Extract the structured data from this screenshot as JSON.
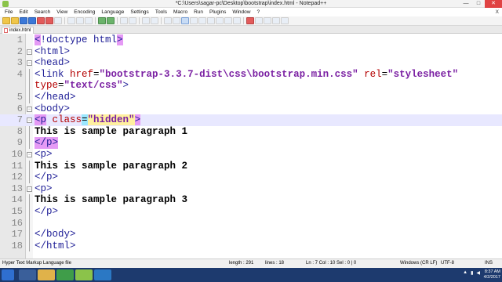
{
  "window": {
    "title": "*C:\\Users\\sagar-pc\\Desktop\\bootstrap\\index.html - Notepad++",
    "minimize": "—",
    "maximize": "□",
    "close": "✕"
  },
  "menu": {
    "items": [
      "File",
      "Edit",
      "Search",
      "View",
      "Encoding",
      "Language",
      "Settings",
      "Tools",
      "Macro",
      "Run",
      "Plugins",
      "Window",
      "?"
    ],
    "close_label": "X"
  },
  "tab": {
    "label": "index.html"
  },
  "editor": {
    "lines": [
      "1",
      "2",
      "3",
      "4",
      "",
      "5",
      "6",
      "7",
      "8",
      "9",
      "10",
      "11",
      "12",
      "13",
      "14",
      "15",
      "16",
      "17",
      "18"
    ],
    "code": {
      "l1_open": "<",
      "l1_rest": "!doctype html",
      "l1_close": ">",
      "l2": "<html>",
      "l3": "<head>",
      "l4_a": "<link ",
      "l4_attr1": "href",
      "l4_eq1": "=",
      "l4_val1": "\"bootstrap-3.3.7-dist\\css\\bootstrap.min.css\"",
      "l4_attr2": " rel",
      "l4_eq2": "=",
      "l4_val2": "\"stylesheet\"",
      "l4b_attr": "type",
      "l4b_eq": "=",
      "l4b_val": "\"text/css\"",
      "l4b_end": ">",
      "l5": "</head>",
      "l6": "<body>",
      "l7_tag": "<p",
      "l7_attr": " class",
      "l7_eq": "=",
      "l7_val": "\"hidden\"",
      "l7_end": ">",
      "l8": "This is sample paragraph 1",
      "l9": "</p>",
      "l10": "<p>",
      "l11": "This is sample paragraph 2",
      "l12": "</p>",
      "l13": "<p>",
      "l14": "This is sample paragraph 3",
      "l15": "</p>",
      "l16": "",
      "l17": "</body>",
      "l18": "</html>"
    }
  },
  "status": {
    "language": "Hyper Text Markup Language file",
    "length": "length : 291",
    "lines": "lines : 18",
    "position": "Ln : 7    Col : 10    Sel : 0 | 0",
    "eol": "Windows (CR LF)",
    "encoding": "UTF-8",
    "mode": "INS"
  },
  "taskbar": {
    "clock_time": "8:37 AM",
    "clock_date": "4/2/2017"
  }
}
